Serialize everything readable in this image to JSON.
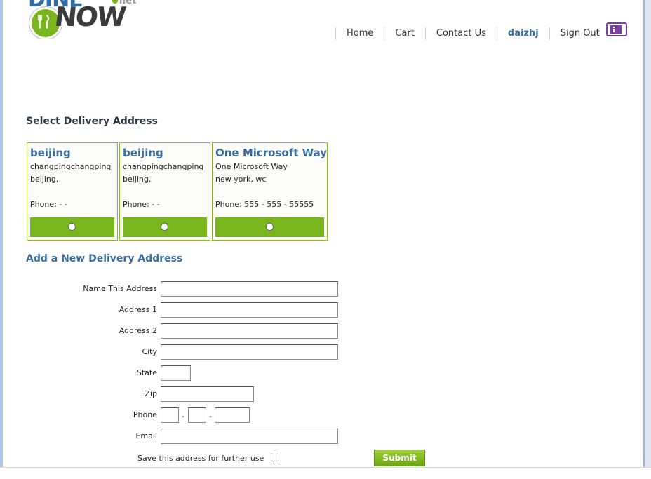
{
  "logo": {
    "top_letters": "DINE",
    "main": "NOW",
    "suffix": "net"
  },
  "nav": {
    "items": [
      "Home",
      "Cart",
      "Contact Us"
    ],
    "user": "daizhj",
    "signout": "Sign Out",
    "info_icon": "info-icon"
  },
  "select_heading": "Select Delivery Address",
  "addresses": [
    {
      "name": "beijing",
      "line1": "changpingchangping",
      "line2": "beijing,",
      "phone": "Phone: - -"
    },
    {
      "name": "beijing",
      "line1": "changpingchangping",
      "line2": "beijing,",
      "phone": "Phone: - -"
    },
    {
      "name": "One Microsoft Way",
      "line1": "One Microsoft Way",
      "line2": "new york, wc",
      "phone": "Phone: 555 - 555 - 55555"
    }
  ],
  "new_heading": "Add a New Delivery Address",
  "form": {
    "name_label": "Name This Address",
    "address1_label": "Address 1",
    "address2_label": "Address 2",
    "city_label": "City",
    "state_label": "State",
    "zip_label": "Zip",
    "phone_label": "Phone",
    "phone_sep": "-",
    "email_label": "Email",
    "save_label": "Save this address for further use",
    "submit_label": "Submit"
  },
  "colors": {
    "accent_green": "#79b51c",
    "link_blue": "#3a6e9e",
    "frame_blue": "#a9c6e6"
  }
}
